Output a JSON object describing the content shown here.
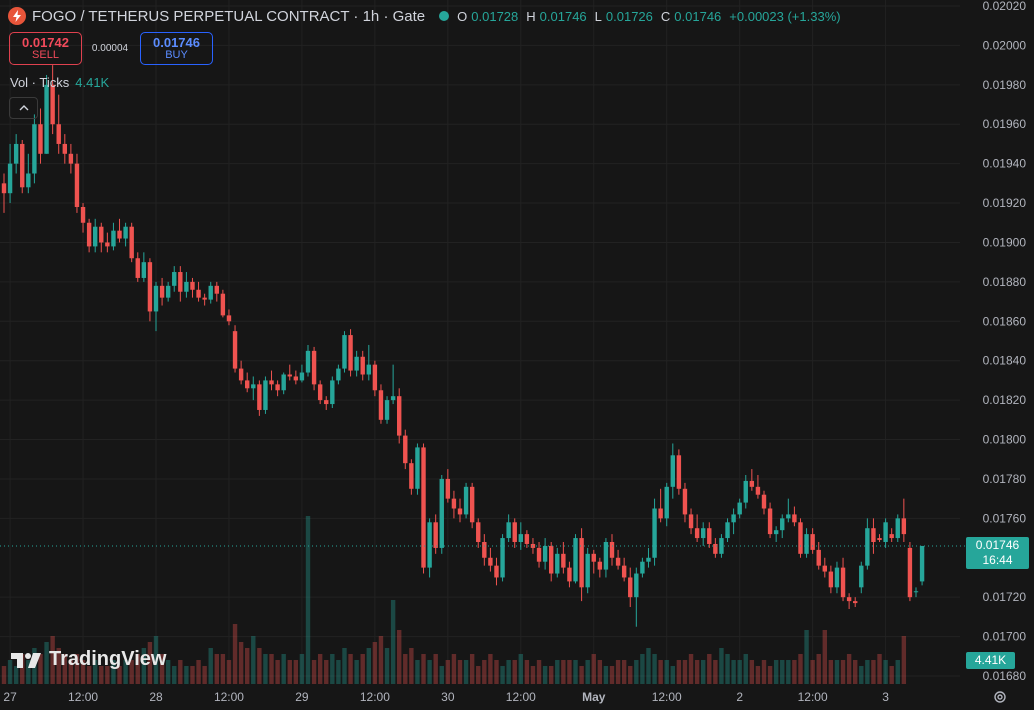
{
  "header": {
    "title": "FOGO / TETHERUS PERPETUAL CONTRACT · 1h · Gate",
    "ohlc": [
      {
        "k": "O",
        "v": "0.01728"
      },
      {
        "k": "H",
        "v": "0.01746"
      },
      {
        "k": "L",
        "v": "0.01726"
      },
      {
        "k": "C",
        "v": "0.01746"
      }
    ],
    "change": "+0.00023 (+1.33%)"
  },
  "trade": {
    "sell_price": "0.01742",
    "sell_label": "SELL",
    "spread": "0.00004",
    "buy_price": "0.01746",
    "buy_label": "BUY"
  },
  "volume_legend": {
    "label": "Vol · Ticks",
    "value": "4.41K"
  },
  "branding": {
    "name": "TradingView"
  },
  "last_price_tag": {
    "price": "0.01746",
    "countdown": "16:44"
  },
  "volume_tag": "4.41K",
  "colors": {
    "up": "#26a69a",
    "down": "#ef5350",
    "background": "#161616",
    "grid": "#222222"
  },
  "chart_data": {
    "type": "candlestick",
    "interval": "1h",
    "y_axis": {
      "min": 0.0168,
      "max": 0.0202,
      "ticks": [
        "0.02020",
        "0.02000",
        "0.01980",
        "0.01960",
        "0.01940",
        "0.01920",
        "0.01900",
        "0.01880",
        "0.01860",
        "0.01840",
        "0.01820",
        "0.01800",
        "0.01780",
        "0.01760",
        "0.01720",
        "0.01700",
        "0.01680"
      ]
    },
    "x_axis": {
      "labels": [
        {
          "label": "27",
          "t": 1
        },
        {
          "label": "12:00",
          "t": 13
        },
        {
          "label": "28",
          "t": 25
        },
        {
          "label": "12:00",
          "t": 37
        },
        {
          "label": "29",
          "t": 49
        },
        {
          "label": "12:00",
          "t": 61
        },
        {
          "label": "30",
          "t": 73
        },
        {
          "label": "12:00",
          "t": 85
        },
        {
          "label": "May",
          "t": 97
        },
        {
          "label": "12:00",
          "t": 109
        },
        {
          "label": "2",
          "t": 121
        },
        {
          "label": "12:00",
          "t": 133
        },
        {
          "label": "3",
          "t": 145
        }
      ]
    },
    "candles": [
      [
        0.0193,
        0.01935,
        0.01915,
        0.01925
      ],
      [
        0.01925,
        0.0195,
        0.0192,
        0.0194
      ],
      [
        0.0194,
        0.01955,
        0.01935,
        0.0195
      ],
      [
        0.0195,
        0.01952,
        0.01925,
        0.01928
      ],
      [
        0.01928,
        0.01945,
        0.01925,
        0.01935
      ],
      [
        0.01935,
        0.01965,
        0.0193,
        0.0196
      ],
      [
        0.0196,
        0.01968,
        0.0194,
        0.01945
      ],
      [
        0.01945,
        0.01985,
        0.01945,
        0.0198
      ],
      [
        0.0198,
        0.0199,
        0.01955,
        0.0196
      ],
      [
        0.0196,
        0.01975,
        0.01945,
        0.0195
      ],
      [
        0.0195,
        0.01955,
        0.0194,
        0.01945
      ],
      [
        0.01945,
        0.0195,
        0.01935,
        0.0194
      ],
      [
        0.0194,
        0.01945,
        0.01915,
        0.01918
      ],
      [
        0.01918,
        0.0192,
        0.01905,
        0.0191
      ],
      [
        0.0191,
        0.01912,
        0.01895,
        0.01898
      ],
      [
        0.01898,
        0.01912,
        0.01895,
        0.01908
      ],
      [
        0.01908,
        0.0191,
        0.01895,
        0.019
      ],
      [
        0.019,
        0.01905,
        0.01895,
        0.01898
      ],
      [
        0.01898,
        0.0191,
        0.01896,
        0.01906
      ],
      [
        0.01906,
        0.01912,
        0.019,
        0.01902
      ],
      [
        0.01902,
        0.0191,
        0.01898,
        0.01908
      ],
      [
        0.01908,
        0.0191,
        0.0189,
        0.01892
      ],
      [
        0.01892,
        0.01895,
        0.0188,
        0.01882
      ],
      [
        0.01882,
        0.01895,
        0.0188,
        0.0189
      ],
      [
        0.0189,
        0.01892,
        0.0186,
        0.01865
      ],
      [
        0.01865,
        0.0188,
        0.01855,
        0.01878
      ],
      [
        0.01878,
        0.01882,
        0.01868,
        0.01872
      ],
      [
        0.01872,
        0.0188,
        0.0187,
        0.01878
      ],
      [
        0.01878,
        0.01888,
        0.01875,
        0.01885
      ],
      [
        0.01885,
        0.01888,
        0.0187,
        0.01875
      ],
      [
        0.01875,
        0.01885,
        0.01872,
        0.0188
      ],
      [
        0.0188,
        0.01882,
        0.01872,
        0.01876
      ],
      [
        0.01876,
        0.0188,
        0.0187,
        0.01872
      ],
      [
        0.01872,
        0.01874,
        0.01868,
        0.01871
      ],
      [
        0.01871,
        0.0188,
        0.01869,
        0.01878
      ],
      [
        0.01878,
        0.0188,
        0.0187,
        0.01874
      ],
      [
        0.01874,
        0.01876,
        0.01862,
        0.01863
      ],
      [
        0.01863,
        0.01866,
        0.01858,
        0.0186
      ],
      [
        0.01855,
        0.01858,
        0.01834,
        0.01836
      ],
      [
        0.01836,
        0.0184,
        0.01828,
        0.0183
      ],
      [
        0.0183,
        0.01834,
        0.01824,
        0.01826
      ],
      [
        0.01826,
        0.01832,
        0.0182,
        0.01828
      ],
      [
        0.01828,
        0.0183,
        0.01812,
        0.01815
      ],
      [
        0.01815,
        0.01832,
        0.01813,
        0.0183
      ],
      [
        0.0183,
        0.01835,
        0.01825,
        0.01828
      ],
      [
        0.01828,
        0.0183,
        0.01822,
        0.01825
      ],
      [
        0.01825,
        0.01834,
        0.01823,
        0.01833
      ],
      [
        0.01833,
        0.01838,
        0.0183,
        0.01832
      ],
      [
        0.01832,
        0.01835,
        0.01828,
        0.0183
      ],
      [
        0.0183,
        0.01838,
        0.01829,
        0.01834
      ],
      [
        0.01834,
        0.01848,
        0.01832,
        0.01845
      ],
      [
        0.01845,
        0.01847,
        0.01825,
        0.01828
      ],
      [
        0.01828,
        0.0183,
        0.01818,
        0.0182
      ],
      [
        0.0182,
        0.01822,
        0.01815,
        0.01818
      ],
      [
        0.01818,
        0.01832,
        0.01816,
        0.0183
      ],
      [
        0.0183,
        0.01838,
        0.01828,
        0.01836
      ],
      [
        0.01836,
        0.01855,
        0.01834,
        0.01853
      ],
      [
        0.01853,
        0.01856,
        0.01832,
        0.01835
      ],
      [
        0.01835,
        0.01845,
        0.01832,
        0.01842
      ],
      [
        0.01842,
        0.01845,
        0.0183,
        0.01833
      ],
      [
        0.01833,
        0.01848,
        0.0183,
        0.01838
      ],
      [
        0.01838,
        0.0184,
        0.01822,
        0.01825
      ],
      [
        0.01825,
        0.01828,
        0.01808,
        0.0181
      ],
      [
        0.0181,
        0.01822,
        0.01808,
        0.0182
      ],
      [
        0.0182,
        0.01838,
        0.01818,
        0.01822
      ],
      [
        0.01822,
        0.01826,
        0.01798,
        0.01802
      ],
      [
        0.01802,
        0.01805,
        0.01785,
        0.01788
      ],
      [
        0.01788,
        0.0179,
        0.01772,
        0.01775
      ],
      [
        0.01775,
        0.01798,
        0.01772,
        0.01796
      ],
      [
        0.01796,
        0.01798,
        0.01732,
        0.01735
      ],
      [
        0.01735,
        0.0176,
        0.0173,
        0.01758
      ],
      [
        0.01758,
        0.01762,
        0.01742,
        0.01745
      ],
      [
        0.01745,
        0.01782,
        0.01742,
        0.0178
      ],
      [
        0.0178,
        0.01785,
        0.01768,
        0.0177
      ],
      [
        0.0177,
        0.01774,
        0.0176,
        0.01765
      ],
      [
        0.01765,
        0.0177,
        0.01758,
        0.01762
      ],
      [
        0.01762,
        0.01778,
        0.0176,
        0.01776
      ],
      [
        0.01776,
        0.01778,
        0.01755,
        0.01758
      ],
      [
        0.01758,
        0.0176,
        0.01745,
        0.01748
      ],
      [
        0.01748,
        0.01752,
        0.01736,
        0.0174
      ],
      [
        0.0174,
        0.01745,
        0.01733,
        0.01736
      ],
      [
        0.01736,
        0.0174,
        0.01726,
        0.0173
      ],
      [
        0.0173,
        0.01752,
        0.01728,
        0.0175
      ],
      [
        0.0175,
        0.01762,
        0.01748,
        0.01758
      ],
      [
        0.01758,
        0.0176,
        0.01745,
        0.01748
      ],
      [
        0.01748,
        0.01758,
        0.01744,
        0.01752
      ],
      [
        0.01752,
        0.01754,
        0.01745,
        0.01747
      ],
      [
        0.01747,
        0.0175,
        0.01742,
        0.01745
      ],
      [
        0.01745,
        0.01748,
        0.01735,
        0.01738
      ],
      [
        0.01738,
        0.0175,
        0.01734,
        0.01746
      ],
      [
        0.01746,
        0.01748,
        0.01728,
        0.01732
      ],
      [
        0.01732,
        0.01745,
        0.0173,
        0.01742
      ],
      [
        0.01742,
        0.01748,
        0.01732,
        0.01735
      ],
      [
        0.01735,
        0.01738,
        0.01725,
        0.01728
      ],
      [
        0.01728,
        0.01752,
        0.01727,
        0.0175
      ],
      [
        0.0175,
        0.01755,
        0.01718,
        0.01725
      ],
      [
        0.01725,
        0.01745,
        0.01722,
        0.01742
      ],
      [
        0.01742,
        0.01744,
        0.01732,
        0.01738
      ],
      [
        0.01738,
        0.0174,
        0.0173,
        0.01734
      ],
      [
        0.01734,
        0.0175,
        0.0173,
        0.01748
      ],
      [
        0.01748,
        0.01752,
        0.01736,
        0.0174
      ],
      [
        0.0174,
        0.01744,
        0.01734,
        0.01736
      ],
      [
        0.01736,
        0.0174,
        0.01728,
        0.0173
      ],
      [
        0.0173,
        0.01735,
        0.01715,
        0.0172
      ],
      [
        0.0172,
        0.01735,
        0.01705,
        0.01732
      ],
      [
        0.01732,
        0.0174,
        0.0173,
        0.01738
      ],
      [
        0.01738,
        0.01745,
        0.01735,
        0.0174
      ],
      [
        0.0174,
        0.0177,
        0.01736,
        0.01765
      ],
      [
        0.01765,
        0.01775,
        0.01758,
        0.0176
      ],
      [
        0.0176,
        0.01778,
        0.01756,
        0.01776
      ],
      [
        0.01776,
        0.01798,
        0.0177,
        0.01792
      ],
      [
        0.01792,
        0.01795,
        0.01772,
        0.01775
      ],
      [
        0.01775,
        0.01778,
        0.01758,
        0.01762
      ],
      [
        0.01762,
        0.01765,
        0.01752,
        0.01755
      ],
      [
        0.01755,
        0.01762,
        0.01748,
        0.0175
      ],
      [
        0.0175,
        0.01758,
        0.01746,
        0.01755
      ],
      [
        0.01755,
        0.01758,
        0.01745,
        0.01747
      ],
      [
        0.01747,
        0.0175,
        0.0174,
        0.01742
      ],
      [
        0.01742,
        0.01752,
        0.0174,
        0.0175
      ],
      [
        0.0175,
        0.0176,
        0.01748,
        0.01758
      ],
      [
        0.01758,
        0.01765,
        0.01752,
        0.01762
      ],
      [
        0.01762,
        0.0177,
        0.0176,
        0.01768
      ],
      [
        0.01768,
        0.01782,
        0.01765,
        0.01779
      ],
      [
        0.01779,
        0.01785,
        0.01774,
        0.01776
      ],
      [
        0.01776,
        0.01782,
        0.0177,
        0.01772
      ],
      [
        0.01772,
        0.01774,
        0.01762,
        0.01765
      ],
      [
        0.01765,
        0.01768,
        0.0175,
        0.01752
      ],
      [
        0.01752,
        0.01756,
        0.01748,
        0.01754
      ],
      [
        0.01754,
        0.01762,
        0.0175,
        0.0176
      ],
      [
        0.0176,
        0.0177,
        0.01758,
        0.01762
      ],
      [
        0.01762,
        0.01766,
        0.01756,
        0.01758
      ],
      [
        0.01758,
        0.0176,
        0.0174,
        0.01742
      ],
      [
        0.01742,
        0.01755,
        0.0174,
        0.01752
      ],
      [
        0.01752,
        0.01755,
        0.01742,
        0.01744
      ],
      [
        0.01744,
        0.01748,
        0.01734,
        0.01736
      ],
      [
        0.01736,
        0.0174,
        0.0173,
        0.01733
      ],
      [
        0.01733,
        0.01736,
        0.01722,
        0.01725
      ],
      [
        0.01725,
        0.01738,
        0.01722,
        0.01735
      ],
      [
        0.01735,
        0.0174,
        0.01718,
        0.0172
      ],
      [
        0.0172,
        0.01722,
        0.01714,
        0.01718
      ],
      [
        0.01718,
        0.0172,
        0.01715,
        0.01717
      ],
      [
        0.01725,
        0.01738,
        0.01722,
        0.01736
      ],
      [
        0.01736,
        0.0176,
        0.01734,
        0.01755
      ],
      [
        0.01755,
        0.0176,
        0.01742,
        0.01748
      ],
      [
        0.0175,
        0.01752,
        0.01748,
        0.01749
      ],
      [
        0.01748,
        0.0176,
        0.01745,
        0.01758
      ],
      [
        0.01752,
        0.01755,
        0.01748,
        0.0175
      ],
      [
        0.0175,
        0.01762,
        0.01748,
        0.0176
      ],
      [
        0.0176,
        0.0177,
        0.01748,
        0.01752
      ],
      [
        0.01745,
        0.01748,
        0.01718,
        0.0172
      ],
      [
        0.01723,
        0.01725,
        0.0172,
        0.01723
      ],
      [
        0.01728,
        0.01746,
        0.01726,
        0.01746
      ]
    ],
    "volumes": [
      3,
      4,
      3,
      5,
      4,
      6,
      5,
      7,
      8,
      6,
      5,
      4,
      5,
      4,
      3,
      4,
      3,
      3,
      4,
      3,
      4,
      4,
      5,
      6,
      7,
      8,
      5,
      4,
      3,
      4,
      3,
      3,
      4,
      3,
      6,
      5,
      5,
      4,
      10,
      7,
      6,
      8,
      6,
      5,
      5,
      4,
      5,
      4,
      4,
      5,
      28,
      4,
      5,
      4,
      5,
      4,
      6,
      5,
      4,
      5,
      6,
      7,
      8,
      6,
      14,
      9,
      5,
      6,
      4,
      5,
      4,
      5,
      3,
      4,
      5,
      4,
      4,
      5,
      3,
      4,
      5,
      4,
      3,
      4,
      4,
      5,
      4,
      3,
      4,
      3,
      3,
      4,
      4,
      4,
      4,
      3,
      4,
      5,
      4,
      3,
      3,
      4,
      4,
      3,
      4,
      5,
      6,
      5,
      4,
      4,
      3,
      4,
      4,
      5,
      4,
      4,
      5,
      4,
      6,
      5,
      4,
      4,
      5,
      4,
      3,
      4,
      3,
      4,
      4,
      4,
      4,
      5,
      9,
      4,
      5,
      9,
      4,
      4,
      4,
      5,
      4,
      3,
      4,
      4,
      5,
      4,
      3,
      4,
      8
    ]
  }
}
